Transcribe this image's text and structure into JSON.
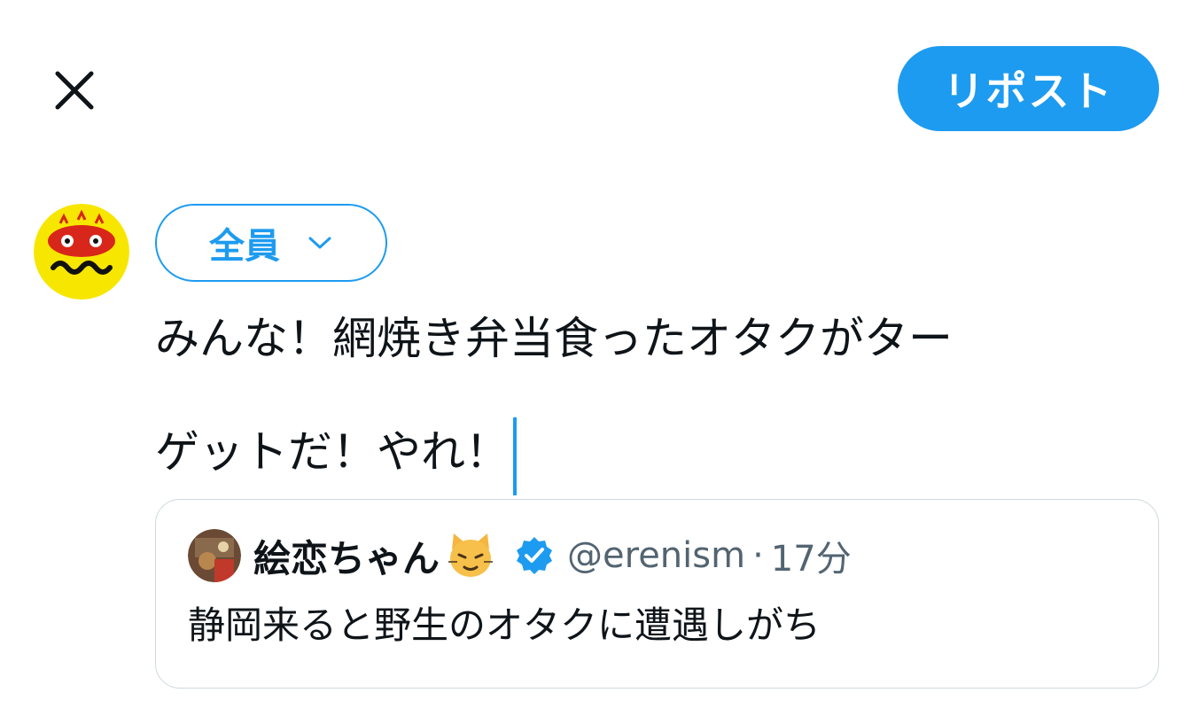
{
  "header": {
    "close_icon": "close-icon",
    "post_label": "リポスト",
    "accent_color": "#1d9bf0"
  },
  "composer": {
    "avatar_icon": "user-avatar-logo",
    "audience_label": "全員",
    "audience_icon": "chevron-down-icon",
    "text_lines": [
      "みんな！網焼き弁当食ったオタクがター",
      "ゲットだ！やれ！"
    ]
  },
  "quote": {
    "avatar_icon": "quoted-user-avatar",
    "display_name": "絵恋ちゃん",
    "emoji_icon": "cat-emoji-icon",
    "verified_icon": "verified-badge-icon",
    "handle": "@erenism",
    "separator": "·",
    "time": "17分",
    "text": "静岡来ると野生のオタクに遭遇しがち"
  }
}
